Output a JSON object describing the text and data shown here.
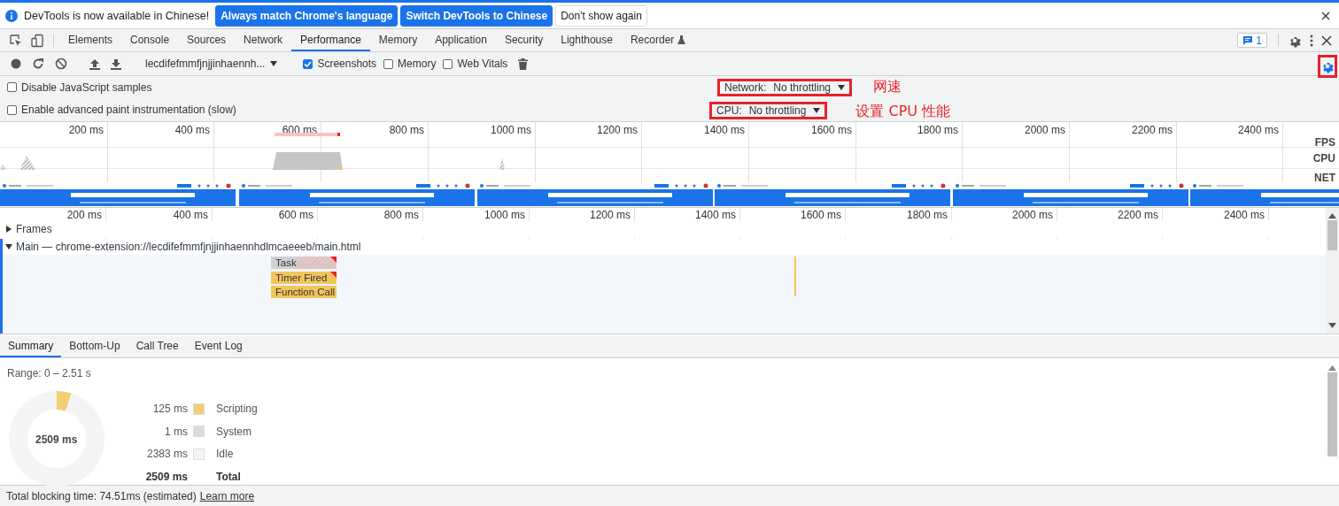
{
  "infobar": {
    "message": "DevTools is now available in Chinese!",
    "buttons": [
      {
        "label": "Always match Chrome's language",
        "kind": "primary"
      },
      {
        "label": "Switch DevTools to Chinese",
        "kind": "primary"
      },
      {
        "label": "Don't show again",
        "kind": "plain"
      }
    ]
  },
  "tabs": [
    {
      "label": "Elements",
      "selected": false,
      "experimental": false
    },
    {
      "label": "Console",
      "selected": false,
      "experimental": false
    },
    {
      "label": "Sources",
      "selected": false,
      "experimental": false
    },
    {
      "label": "Network",
      "selected": false,
      "experimental": false
    },
    {
      "label": "Performance",
      "selected": true,
      "experimental": false
    },
    {
      "label": "Memory",
      "selected": false,
      "experimental": false
    },
    {
      "label": "Application",
      "selected": false,
      "experimental": false
    },
    {
      "label": "Security",
      "selected": false,
      "experimental": false
    },
    {
      "label": "Lighthouse",
      "selected": false,
      "experimental": false
    },
    {
      "label": "Recorder",
      "selected": false,
      "experimental": true
    }
  ],
  "issues_badge": "1",
  "toolbar": {
    "profile_select": "lecdifefmmfjnjjinhaennh...",
    "checkboxes": [
      {
        "label": "Screenshots",
        "checked": true
      },
      {
        "label": "Memory",
        "checked": false
      },
      {
        "label": "Web Vitals",
        "checked": false
      }
    ]
  },
  "settings": {
    "checkboxes": [
      {
        "label": "Disable JavaScript samples",
        "checked": false
      },
      {
        "label": "Enable advanced paint instrumentation (slow)",
        "checked": false
      }
    ],
    "network": {
      "label": "Network:",
      "value": "No throttling"
    },
    "cpu": {
      "label": "CPU:",
      "value": "No throttling"
    }
  },
  "annotations": [
    "网速",
    "设置 CPU 性能"
  ],
  "overview": {
    "ticks": [
      "200 ms",
      "400 ms",
      "600 ms",
      "800 ms",
      "1000 ms",
      "1200 ms",
      "1400 ms",
      "1600 ms",
      "1800 ms",
      "2000 ms",
      "2200 ms",
      "2400 ms"
    ],
    "lanes": [
      "FPS",
      "CPU",
      "NET"
    ],
    "screenshots": [
      {
        "kind": "picture"
      },
      {
        "kind": "picture"
      },
      {
        "kind": "picture"
      },
      {
        "kind": "picture"
      },
      {
        "kind": "picture"
      },
      {
        "kind": "picture"
      }
    ]
  },
  "timeline": {
    "ticks": [
      "200 ms",
      "400 ms",
      "600 ms",
      "800 ms",
      "1000 ms",
      "1200 ms",
      "1400 ms",
      "1600 ms",
      "1800 ms",
      "2000 ms",
      "2200 ms",
      "2400 ms"
    ],
    "tracks": [
      {
        "label": "Frames",
        "expanded": false
      },
      {
        "label": "Main — chrome-extension://lecdifefmmfjnjjinhaennhdlmcaeeeb/main.html",
        "expanded": true
      }
    ],
    "events": [
      {
        "label": "Task",
        "kind": "task"
      },
      {
        "label": "Timer Fired",
        "kind": "script"
      },
      {
        "label": "Function Call",
        "kind": "script"
      }
    ]
  },
  "details_tabs": [
    {
      "label": "Summary",
      "selected": true
    },
    {
      "label": "Bottom-Up",
      "selected": false
    },
    {
      "label": "Call Tree",
      "selected": false
    },
    {
      "label": "Event Log",
      "selected": false
    }
  ],
  "summary": {
    "range": "Range: 0 – 2.51 s",
    "center": "2509 ms",
    "rows": [
      {
        "time": "125 ms",
        "label": "Scripting",
        "color": "#f2ce74"
      },
      {
        "time": "1 ms",
        "label": "System",
        "color": "#dadada"
      },
      {
        "time": "2383 ms",
        "label": "Idle",
        "color": "#f4f4f4"
      }
    ],
    "total": {
      "time": "2509 ms",
      "label": "Total"
    }
  },
  "status": {
    "text": "Total blocking time: 74.51ms (estimated)",
    "link": "Learn more"
  }
}
